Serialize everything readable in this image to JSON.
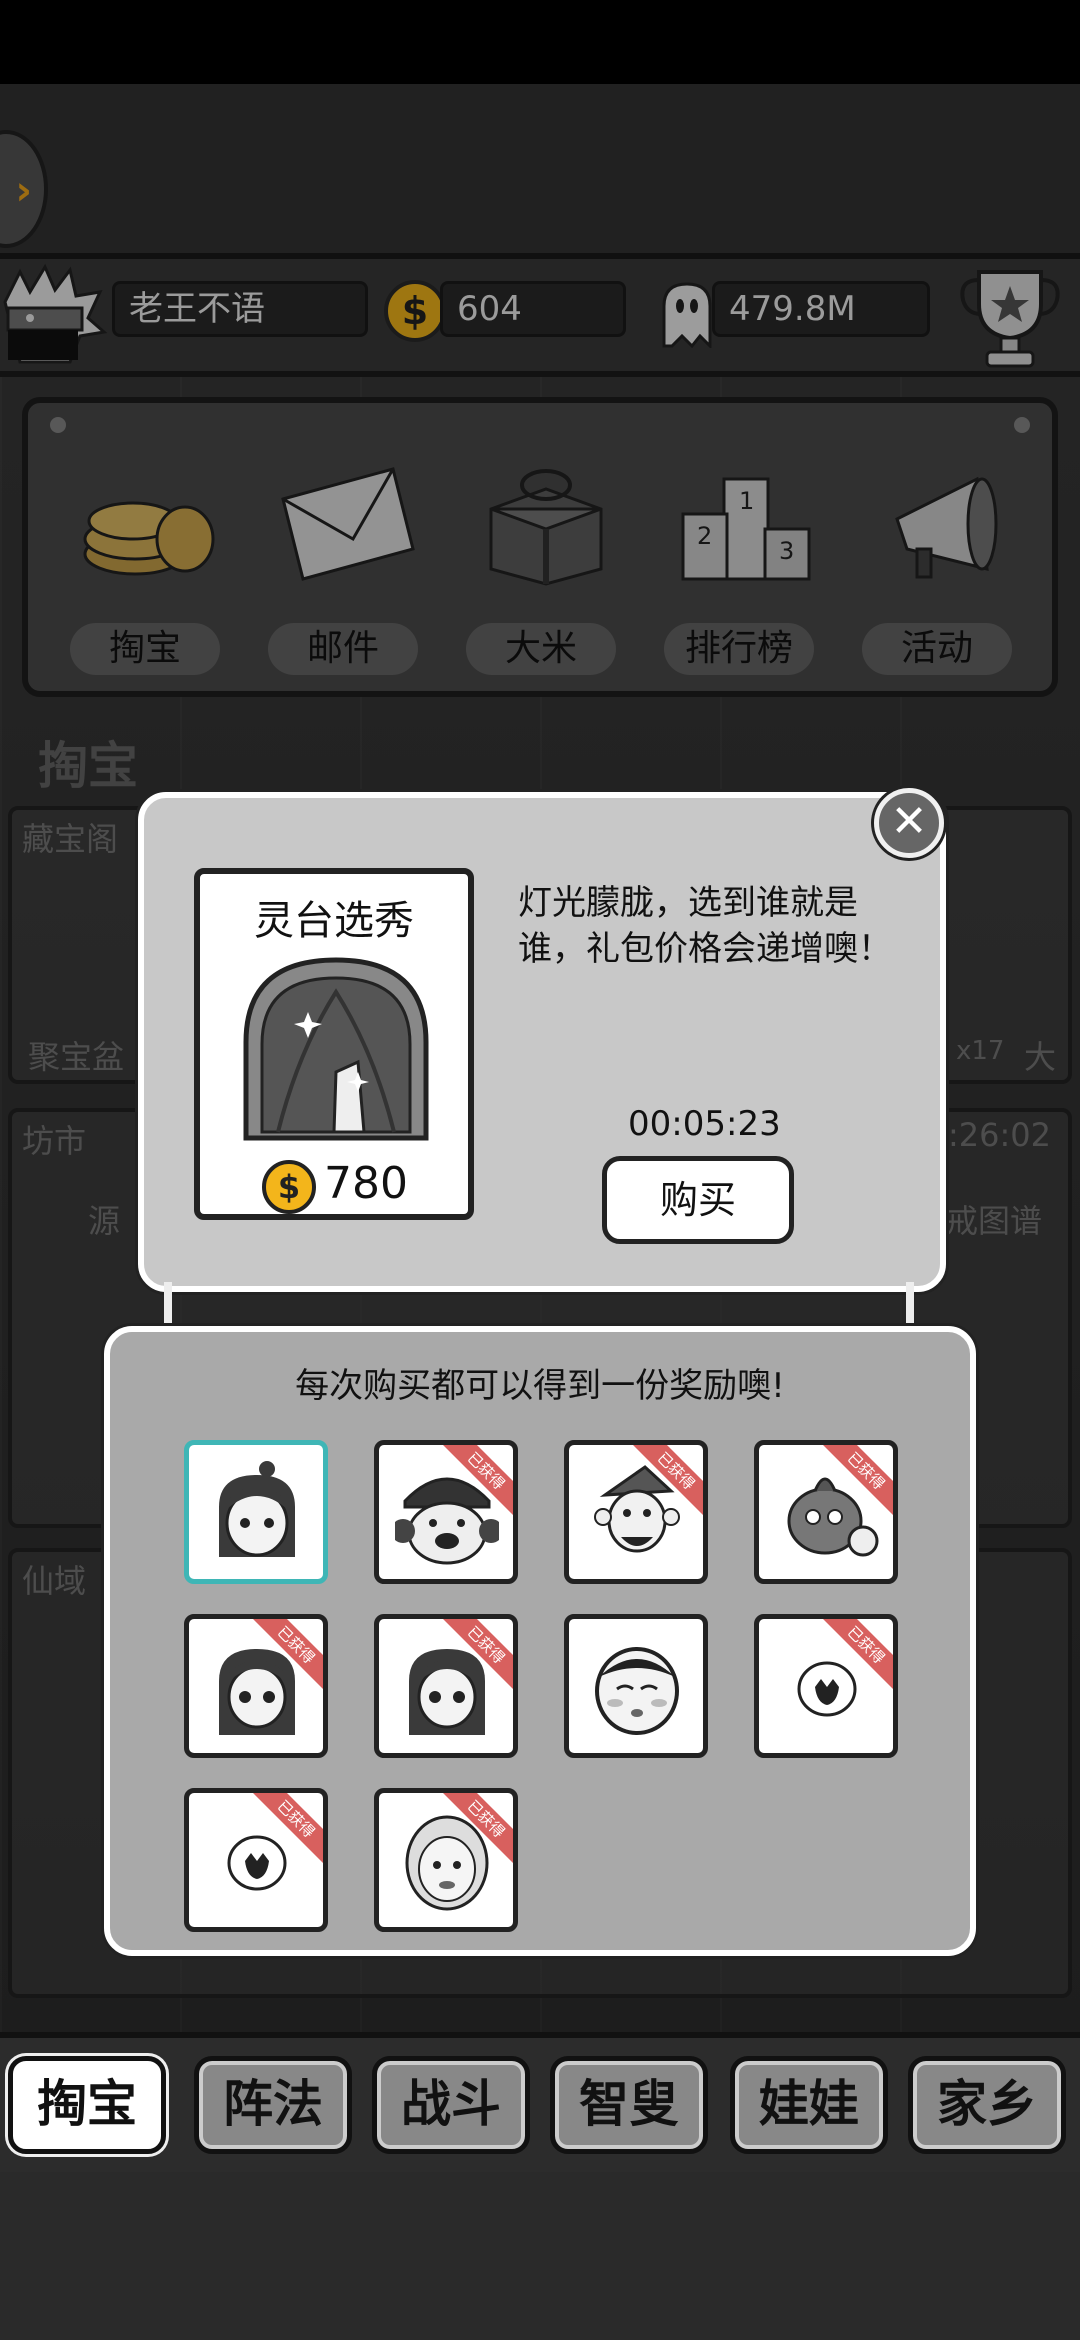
{
  "header": {
    "username": "老王不语",
    "coins": "604",
    "ghost_power": "479.8M"
  },
  "menu": [
    {
      "label": "掏宝",
      "icon": "coins-icon"
    },
    {
      "label": "邮件",
      "icon": "mail-icon"
    },
    {
      "label": "大米",
      "icon": "gift-icon"
    },
    {
      "label": "排行榜",
      "icon": "podium-icon"
    },
    {
      "label": "活动",
      "icon": "megaphone-icon"
    }
  ],
  "background": {
    "section_title": "掏宝",
    "box1_title": "藏宝阁",
    "box1_item": "聚宝盆",
    "box1_count": "x17",
    "box1_right": "大",
    "box2_title": "坊市",
    "box2_timer": ":26:02",
    "box2_left": "源",
    "box2_right": "戒图谱",
    "box3_title": "仙域"
  },
  "offer": {
    "title": "灵台选秀",
    "price": "780",
    "description": "灯光朦胧，选到谁就是谁，礼包价格会递增噢！",
    "timer": "00:05:23",
    "buy_label": "购买",
    "close_icon": "close-icon"
  },
  "rewards": {
    "title": "每次购买都可以得到一份奖励噢!",
    "badge_text": "已获得",
    "items": [
      {
        "name": "girl-topknot",
        "obtained": false,
        "selected": true
      },
      {
        "name": "pirate-dog",
        "obtained": true,
        "selected": false
      },
      {
        "name": "old-man-hat",
        "obtained": true,
        "selected": false
      },
      {
        "name": "orange-creature",
        "obtained": true,
        "selected": false
      },
      {
        "name": "girl-ponytail-a",
        "obtained": true,
        "selected": false
      },
      {
        "name": "girl-ponytail-b",
        "obtained": true,
        "selected": false
      },
      {
        "name": "blushing-face",
        "obtained": false,
        "selected": false
      },
      {
        "name": "seed-a",
        "obtained": true,
        "selected": false
      },
      {
        "name": "seed-b",
        "obtained": true,
        "selected": false
      },
      {
        "name": "hooded-face",
        "obtained": true,
        "selected": false
      }
    ]
  },
  "tabs": [
    {
      "label": "掏宝",
      "active": true
    },
    {
      "label": "阵法",
      "active": false
    },
    {
      "label": "战斗",
      "active": false
    },
    {
      "label": "智叟",
      "active": false
    },
    {
      "label": "娃娃",
      "active": false
    },
    {
      "label": "家乡",
      "active": false
    }
  ],
  "colors": {
    "coin": "#f3b51b",
    "ribbon": "#d8605e",
    "selected_border": "#3fb6b6"
  }
}
